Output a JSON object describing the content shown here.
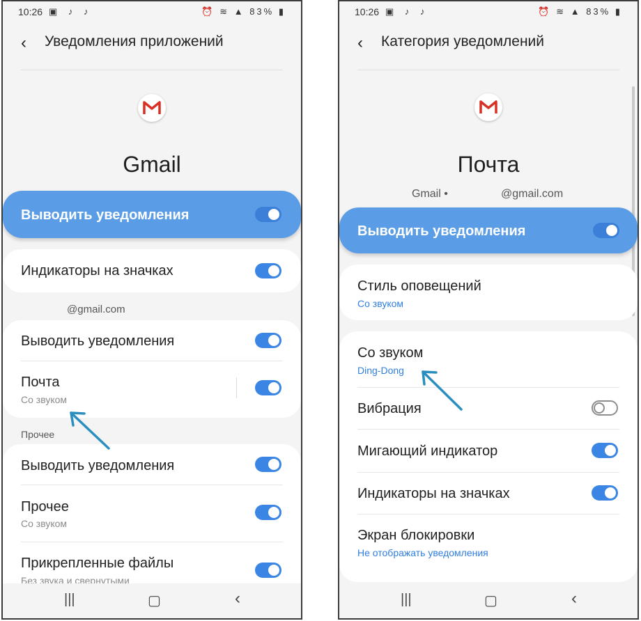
{
  "left": {
    "status": {
      "time": "10:26",
      "battery": "83%"
    },
    "header": {
      "title": "Уведомления приложений"
    },
    "app_name": "Gmail",
    "main_toggle": {
      "label": "Выводить уведомления",
      "on": true
    },
    "badges": {
      "label": "Индикаторы на значках",
      "on": true
    },
    "account_label": "@gmail.com",
    "account_rows": [
      {
        "label": "Выводить уведомления",
        "on": true
      },
      {
        "label": "Почта",
        "sub": "Со звуком",
        "on": true
      }
    ],
    "other_label": "Прочее",
    "other_rows": [
      {
        "label": "Выводить уведомления",
        "on": true
      },
      {
        "label": "Прочее",
        "sub": "Со звуком",
        "on": true
      },
      {
        "label": "Прикрепленные файлы",
        "sub": "Без звука и свернутыми",
        "on": true
      }
    ]
  },
  "right": {
    "status": {
      "time": "10:26",
      "battery": "83%"
    },
    "header": {
      "title": "Категория уведомлений"
    },
    "app_name": "Почта",
    "account_app": "Gmail •",
    "account_email": "@gmail.com",
    "main_toggle": {
      "label": "Выводить уведомления",
      "on": true
    },
    "alert_style": {
      "label": "Стиль оповещений",
      "sub": "Со звуком"
    },
    "rows": [
      {
        "label": "Со звуком",
        "sub": "Ding-Dong"
      },
      {
        "label": "Вибрация",
        "on": false
      },
      {
        "label": "Мигающий индикатор",
        "on": true
      },
      {
        "label": "Индикаторы на значках",
        "on": true
      },
      {
        "label": "Экран блокировки",
        "sub": "Не отображать уведомления"
      }
    ]
  },
  "nav": {
    "recents_icon": "recents-icon",
    "home_icon": "home-icon",
    "back_icon": "back-icon"
  },
  "colors": {
    "accent": "#3b86e4",
    "banner": "#5a9de6",
    "link": "#2f7ee0",
    "arrow": "#2a8fbf"
  }
}
